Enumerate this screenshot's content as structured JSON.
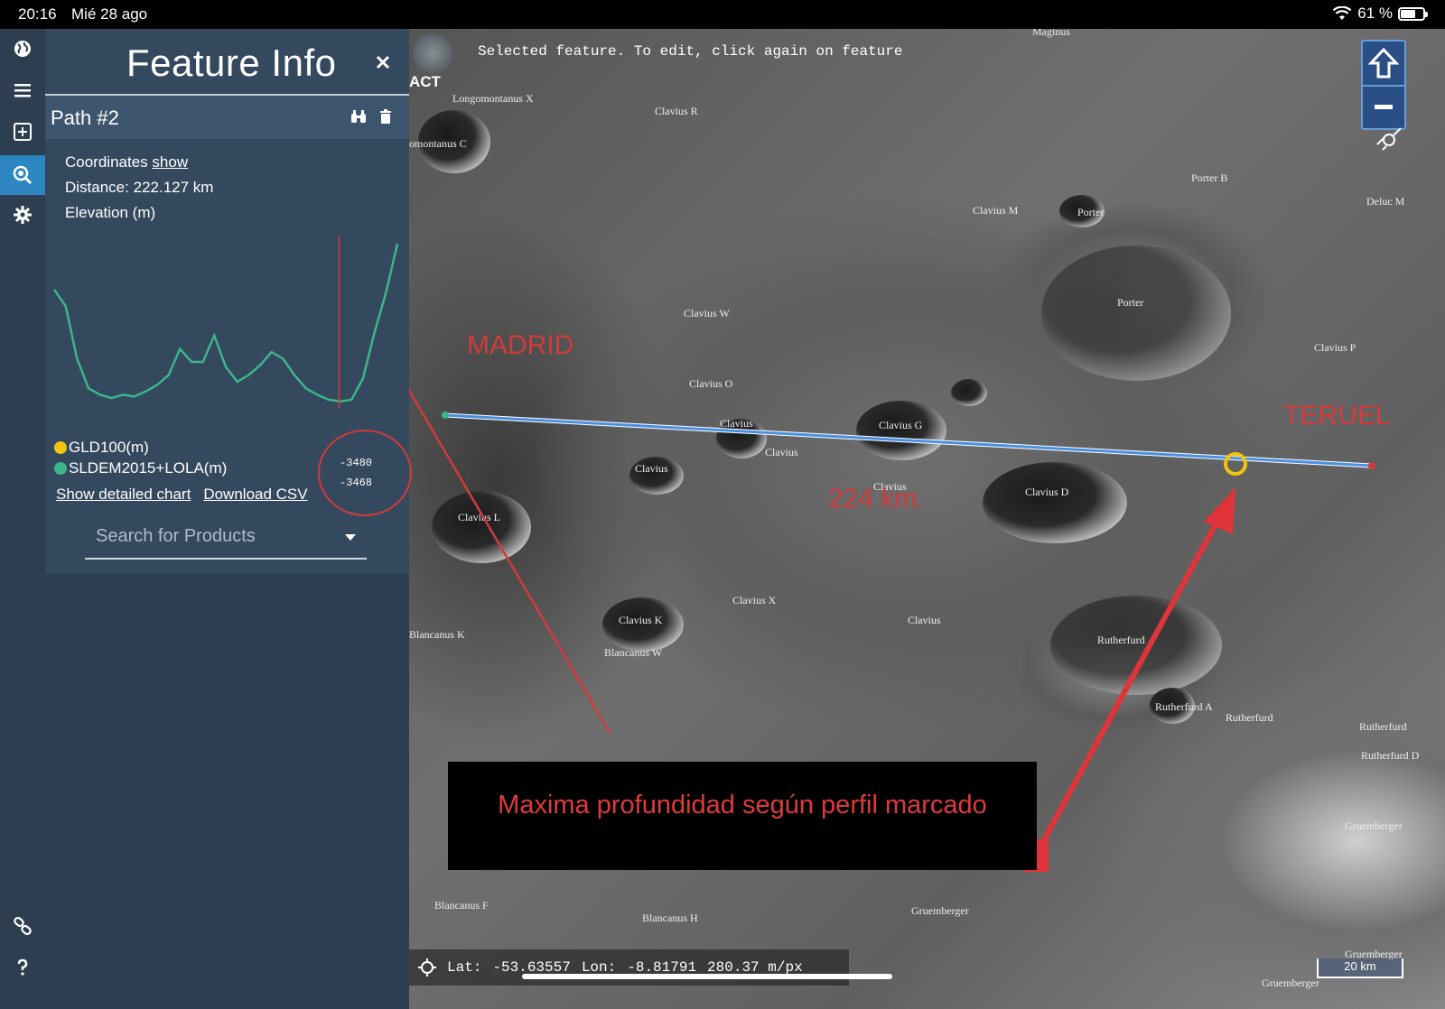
{
  "status_bar": {
    "time": "20:16",
    "date": "Mié 28 ago",
    "battery": "61 %"
  },
  "panel": {
    "title": "Feature Info",
    "path_name": "Path #2",
    "coordinates_label": "Coordinates",
    "coordinates_link": "show",
    "distance_label": "Distance:",
    "distance_value": "222.127 km",
    "elevation_label": "Elevation (m)",
    "tick_values": [
      "-3480",
      "-3468"
    ],
    "legend": [
      {
        "name": "GLD100(m)",
        "color": "#f1c40f"
      },
      {
        "name": "SLDEM2015+LOLA(m)",
        "color": "#3db58a"
      }
    ],
    "show_chart_link": "Show detailed chart",
    "download_link": "Download CSV",
    "search_placeholder": "Search for Products"
  },
  "map": {
    "selected_msg": "Selected feature. To edit, click again on feature",
    "logo_text": "ACT",
    "labels": [
      "Longomontanus X",
      "omontanus C",
      "Clavius R",
      "Maginus",
      "Porter B",
      "Porter",
      "Clavius M",
      "Deluc M",
      "Porter",
      "Clavius W",
      "Clavius P",
      "Clavius O",
      "Clavius G",
      "Clavius",
      "Clavius",
      "Clavius",
      "Clavius",
      "Clavius D",
      "Clavius L",
      "Clavius X",
      "Clavius K",
      "Blancanus K",
      "Blancanus W",
      "Clavius",
      "Rutherfurd",
      "Rutherfurd A",
      "Rutherfurd",
      "Rutherfurd",
      "Rutherfurd D",
      "Gruemberger",
      "Blancanus F",
      "Blancanus H",
      "Gruemberger",
      "Gruemberger",
      "Gruemberger"
    ],
    "annot_madrid": "MADRID",
    "annot_teruel": "TERUEL",
    "annot_distance": "224 km.",
    "annot_box": "Maxima profundidad según perfil marcado",
    "coords": {
      "lat_label": "Lat:",
      "lat": "-53.63557",
      "lon_label": "Lon:",
      "lon": "-8.81791",
      "scale": "280.37 m/px"
    },
    "scale_bar": "20 km"
  },
  "chart_data": {
    "type": "line",
    "title": "",
    "xlabel": "",
    "ylabel": "Elevation (m)",
    "series": [
      {
        "name": "GLD100(m)",
        "values": []
      },
      {
        "name": "SLDEM2015+LOLA(m)",
        "values": [
          0.72,
          0.62,
          0.3,
          0.12,
          0.08,
          0.06,
          0.08,
          0.07,
          0.1,
          0.14,
          0.2,
          0.36,
          0.28,
          0.28,
          0.44,
          0.25,
          0.16,
          0.2,
          0.26,
          0.34,
          0.3,
          0.2,
          0.12,
          0.08,
          0.05,
          0.04,
          0.05,
          0.18,
          0.46,
          0.7,
          1.0
        ]
      }
    ],
    "marker_fraction": 0.83,
    "tick_values": [
      -3480,
      -3468
    ]
  },
  "colors": {
    "panel": "#34495e",
    "rail": "#2c3e50",
    "accent": "#2e86c1",
    "profile": "#3db58a",
    "annot_red": "#d23b3b",
    "path_line": "#4a90e2"
  },
  "icons": [
    "globe-icon",
    "menu-icon",
    "add-layer-icon",
    "search-map-icon",
    "settings-icon",
    "link-icon",
    "help-icon",
    "close-icon",
    "binoculars-icon",
    "trash-icon",
    "home-icon",
    "zoom-out-icon",
    "compass-icon",
    "crosshair-icon"
  ]
}
